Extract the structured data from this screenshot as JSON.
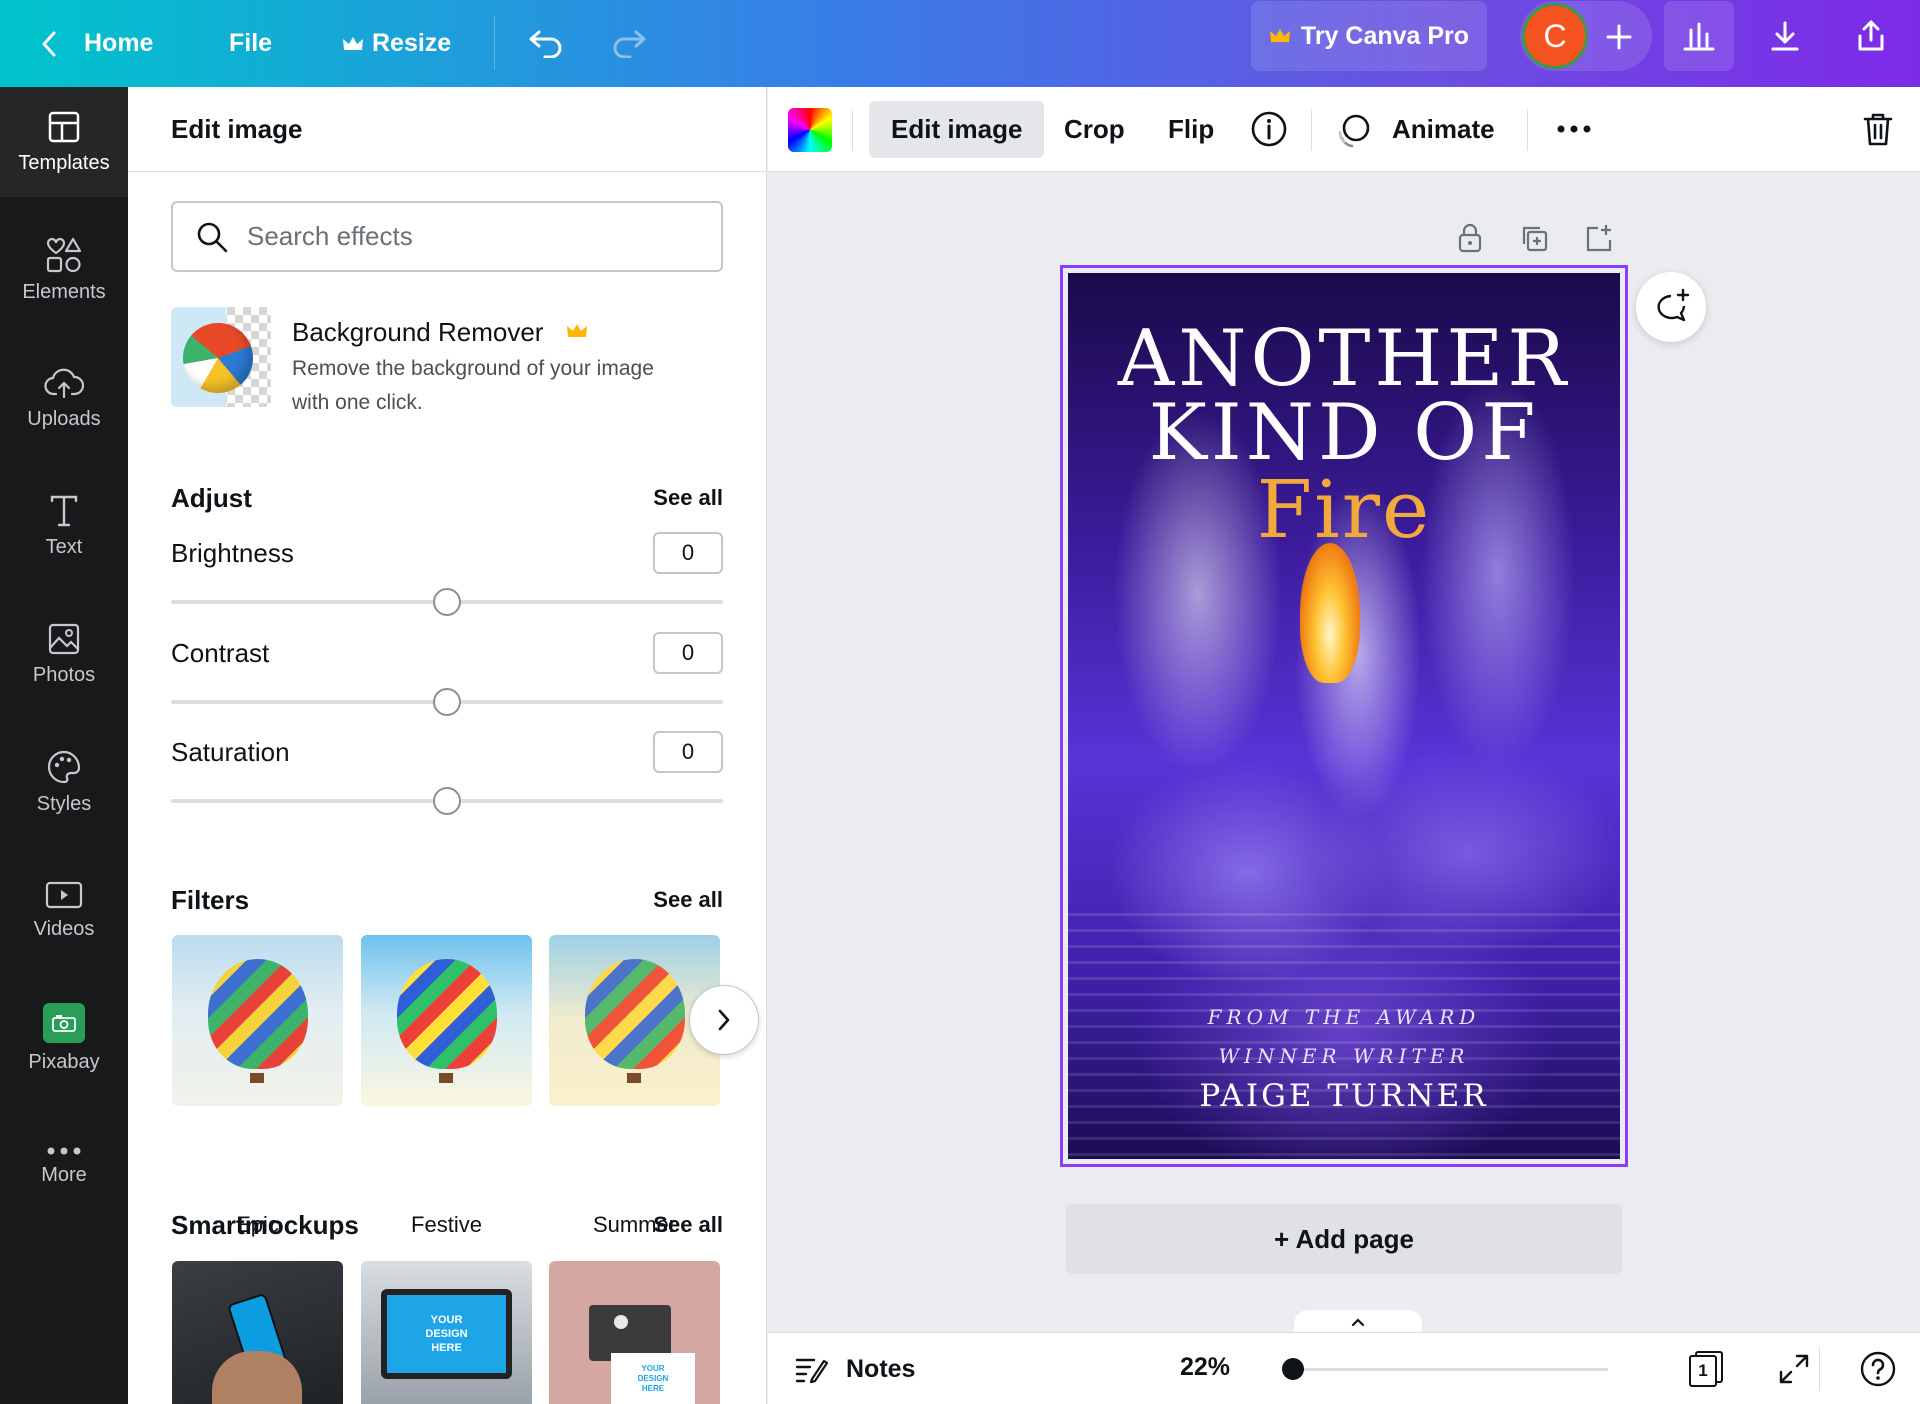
{
  "topbar": {
    "home_label": "Home",
    "file_label": "File",
    "resize_label": "Resize",
    "try_pro_label": "Try Canva Pro",
    "avatar_letter": "C"
  },
  "rail": {
    "items": [
      {
        "label": "Templates",
        "icon": "templates-icon"
      },
      {
        "label": "Elements",
        "icon": "elements-icon"
      },
      {
        "label": "Uploads",
        "icon": "uploads-icon"
      },
      {
        "label": "Text",
        "icon": "text-icon"
      },
      {
        "label": "Photos",
        "icon": "photos-icon"
      },
      {
        "label": "Styles",
        "icon": "styles-icon"
      },
      {
        "label": "Videos",
        "icon": "videos-icon"
      },
      {
        "label": "Pixabay",
        "icon": "pixabay-icon"
      },
      {
        "label": "More",
        "icon": "more-icon"
      }
    ]
  },
  "panel": {
    "title": "Edit image",
    "search_placeholder": "Search effects",
    "bg_remover": {
      "title": "Background Remover",
      "desc_line1": "Remove the background of your image",
      "desc_line2": "with one click."
    },
    "adjust": {
      "title": "Adjust",
      "see_all": "See all",
      "brightness_label": "Brightness",
      "brightness_value": "0",
      "contrast_label": "Contrast",
      "contrast_value": "0",
      "saturation_label": "Saturation",
      "saturation_value": "0"
    },
    "filters": {
      "title": "Filters",
      "see_all": "See all",
      "items": [
        "Epic",
        "Festive",
        "Summer"
      ]
    },
    "smartmockups": {
      "title": "Smartmockups",
      "see_all": "See all",
      "mockup_text": "YOUR DESIGN HERE"
    }
  },
  "toolbar": {
    "edit_image": "Edit image",
    "crop": "Crop",
    "flip": "Flip",
    "animate": "Animate"
  },
  "cover": {
    "line1": "ANOTHER",
    "line2": "KIND OF",
    "line3": "Fire",
    "tagline1": "FROM THE AWARD",
    "tagline2": "WINNER WRITER",
    "author": "PAIGE TURNER"
  },
  "canvas": {
    "add_page": "+ Add page"
  },
  "bottom": {
    "notes": "Notes",
    "zoom": "22%",
    "page_count": "1"
  },
  "colors": {
    "accent": "#8b3dff",
    "avatar_bg": "#f5521f",
    "rail_bg": "#18191b",
    "crown": "#ffb700"
  }
}
